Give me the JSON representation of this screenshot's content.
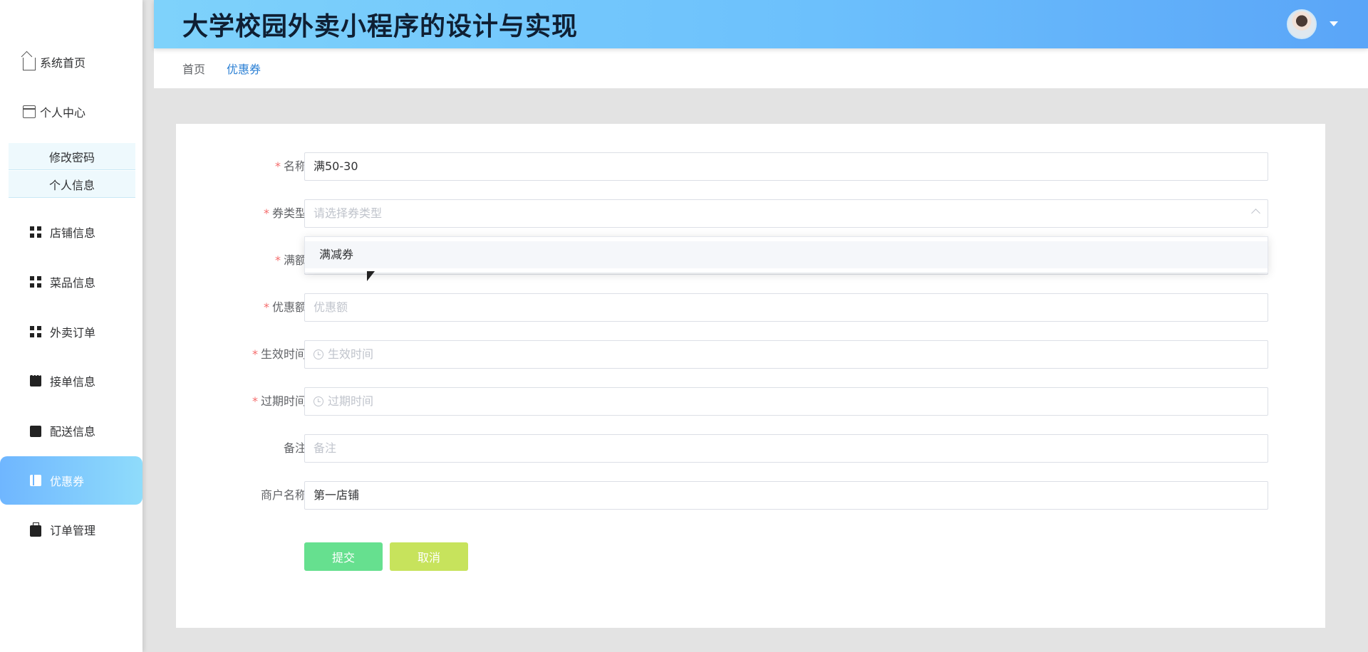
{
  "header": {
    "title": "大学校园外卖小程序的设计与实现"
  },
  "sidebar": {
    "items": [
      {
        "label": "系统首页",
        "icon": "home-icon"
      },
      {
        "label": "个人中心",
        "icon": "card-icon"
      },
      {
        "label": "修改密码"
      },
      {
        "label": "个人信息"
      },
      {
        "label": "店铺信息",
        "icon": "grid-icon"
      },
      {
        "label": "菜品信息",
        "icon": "grid-icon"
      },
      {
        "label": "外卖订单",
        "icon": "grid-icon"
      },
      {
        "label": "接单信息",
        "icon": "chat-icon"
      },
      {
        "label": "配送信息",
        "icon": "wallet-icon"
      },
      {
        "label": "优惠券",
        "icon": "book-icon",
        "active": true
      },
      {
        "label": "订单管理",
        "icon": "briefcase-icon"
      }
    ]
  },
  "breadcrumb": {
    "home": "首页",
    "current": "优惠券"
  },
  "form": {
    "name": {
      "label": "名称",
      "value": "满50-30"
    },
    "type": {
      "label": "券类型",
      "placeholder": "请选择券类型",
      "options": [
        "满减券"
      ]
    },
    "threshold": {
      "label": "满额"
    },
    "discount": {
      "label": "优惠额",
      "placeholder": "优惠额"
    },
    "start": {
      "label": "生效时间",
      "placeholder": "生效时间"
    },
    "end": {
      "label": "过期时间",
      "placeholder": "过期时间"
    },
    "note": {
      "label": "备注",
      "placeholder": "备注"
    },
    "merchant": {
      "label": "商户名称",
      "value": "第一店铺"
    },
    "submit_label": "提交",
    "cancel_label": "取消"
  },
  "colors": {
    "accent": "#2a7fd4",
    "submit": "#66e08f",
    "cancel": "#c7e35c",
    "required": "#f56c6c"
  }
}
